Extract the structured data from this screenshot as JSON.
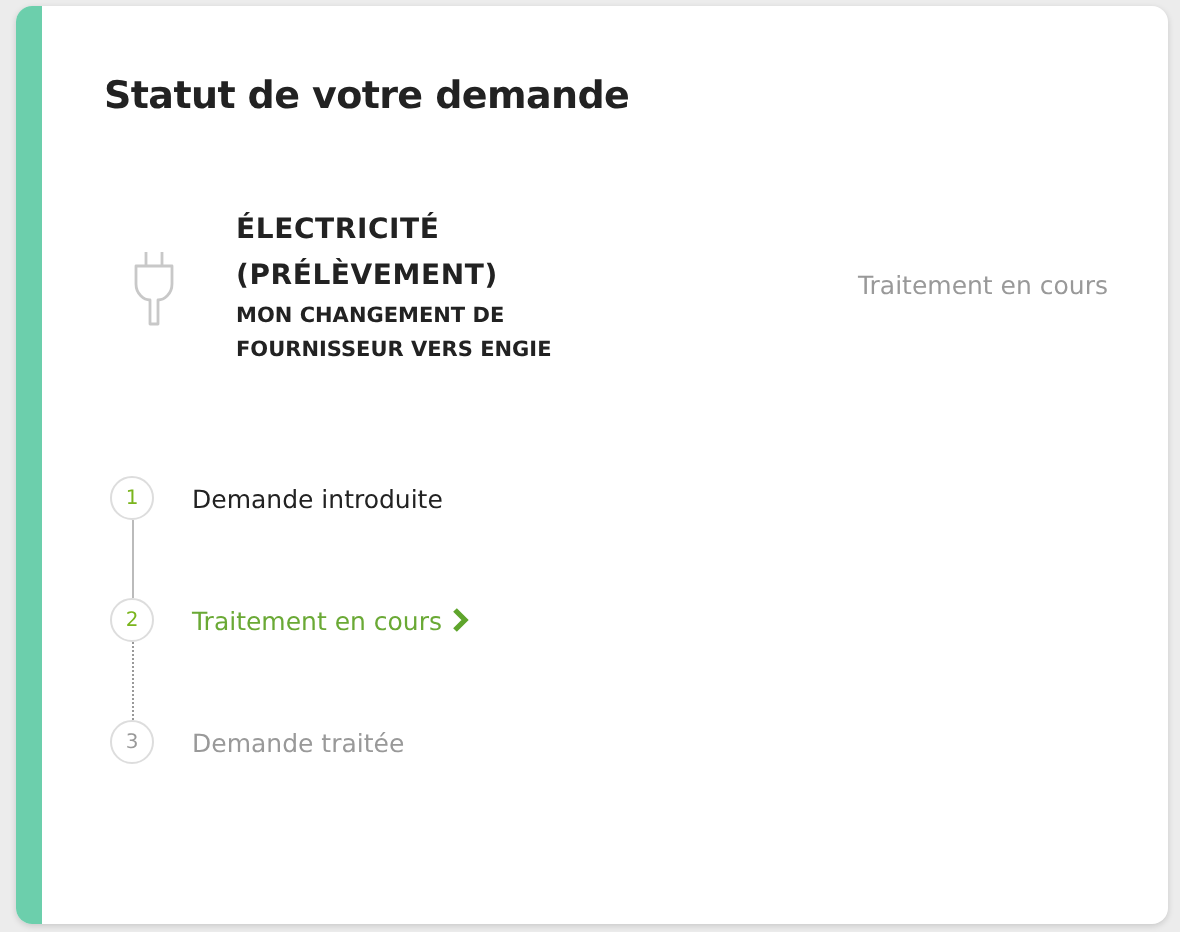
{
  "title": "Statut de votre demande",
  "request": {
    "type": "ÉLECTRICITÉ (PRÉLÈVEMENT)",
    "description": "MON CHANGEMENT DE FOURNISSEUR VERS ENGIE",
    "status": "Traitement en cours"
  },
  "steps": [
    {
      "number": "1",
      "label": "Demande introduite",
      "kind": "done"
    },
    {
      "number": "2",
      "label": "Traitement en cours",
      "kind": "current"
    },
    {
      "number": "3",
      "label": "Demande traitée",
      "kind": "pending"
    }
  ]
}
